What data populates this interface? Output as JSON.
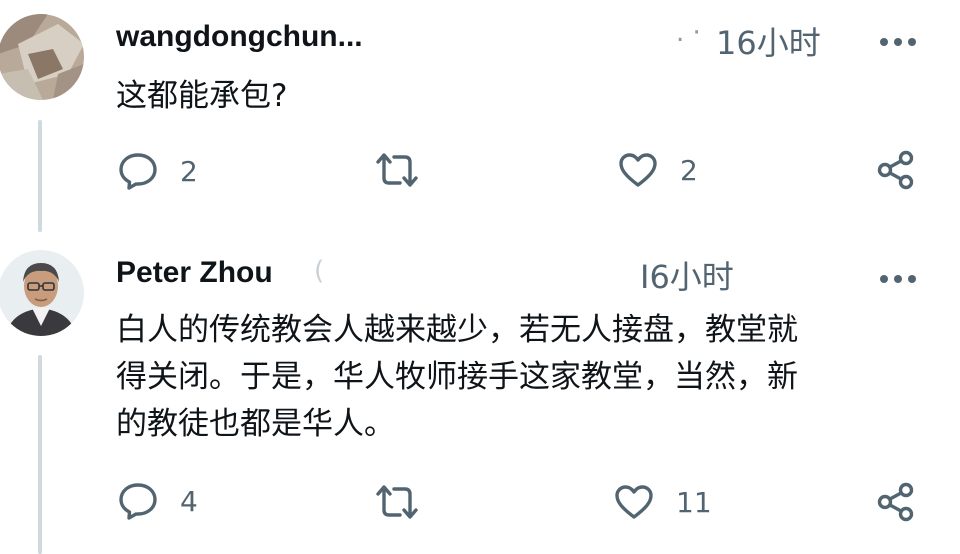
{
  "posts": [
    {
      "username": "wangdongchun...",
      "handle_fragment": ". ·",
      "time": "16小时",
      "text": "这都能承包?",
      "reply_count": "2",
      "like_count": "2"
    },
    {
      "username": "Peter Zhou",
      "handle_fragment": "(",
      "time": "I6小时",
      "text": "白人的传统教会人越来越少，若无人接盘，教堂就\n得关闭。于是，华人牧师接手这家教堂，当然，新\n的教徒也都是华人。",
      "reply_count": "4",
      "like_count": "11"
    }
  ],
  "colors": {
    "text": "#0f1419",
    "muted": "#536471",
    "thread_line": "#cfd9de"
  },
  "icons": [
    "reply-icon",
    "retweet-icon",
    "like-icon",
    "share-icon",
    "more-icon"
  ]
}
